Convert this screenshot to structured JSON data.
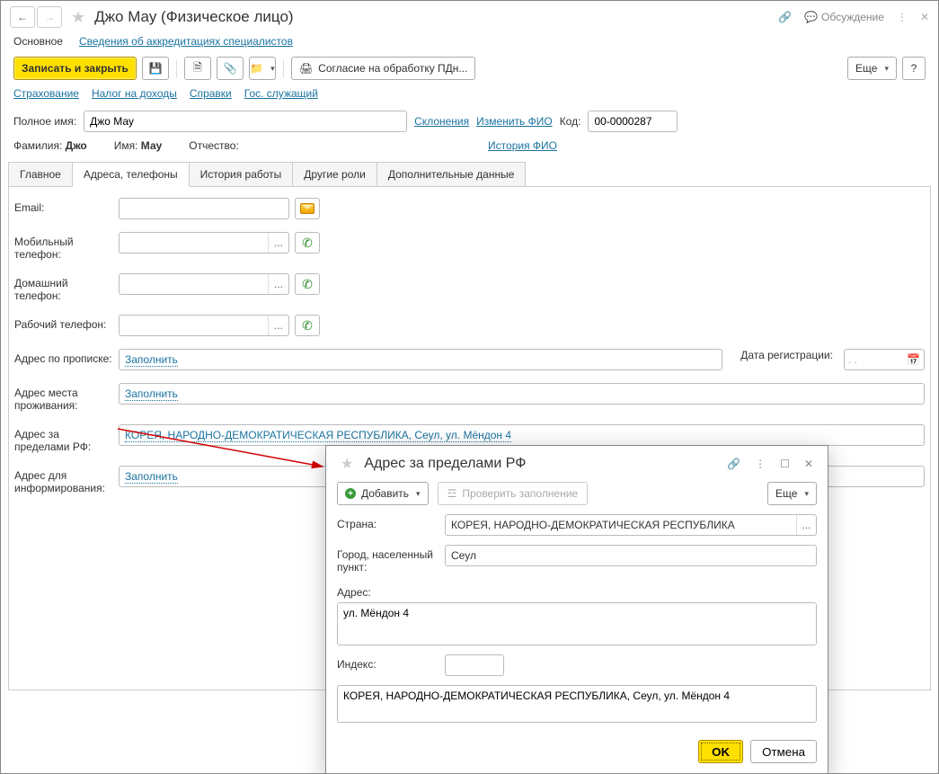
{
  "header": {
    "title": "Джо Мау (Физическое лицо)",
    "discussion": "Обсуждение"
  },
  "subnav": {
    "main": "Основное",
    "accred": "Сведения об аккредитациях специалистов"
  },
  "toolbar": {
    "save_close": "Записать и закрыть",
    "consent": "Согласие на обработку ПДн...",
    "more": "Еще",
    "help": "?"
  },
  "links": {
    "insurance": "Страхование",
    "tax": "Налог на доходы",
    "certs": "Справки",
    "gov": "Гос. служащий"
  },
  "nameRow": {
    "full_label": "Полное имя:",
    "full_value": "Джо Мау",
    "declension": "Склонения",
    "change": "Изменить ФИО",
    "code_label": "Код:",
    "code_value": "00-0000287"
  },
  "nameParts": {
    "surname_lbl": "Фамилия:",
    "surname": "Джо",
    "name_lbl": "Имя:",
    "name": "Мау",
    "patr_lbl": "Отчество:",
    "history": "История ФИО"
  },
  "tabs": {
    "main": "Главное",
    "addr": "Адреса, телефоны",
    "work": "История работы",
    "roles": "Другие роли",
    "extra": "Дополнительные данные"
  },
  "fields": {
    "email": "Email:",
    "mobile": "Мобильный телефон:",
    "home": "Домашний телефон:",
    "work": "Рабочий телефон:",
    "reg_addr": "Адрес по прописке:",
    "fill": "Заполнить",
    "reg_date": "Дата регистрации:",
    "date_placeholder": ". .",
    "live_addr": "Адрес места проживания:",
    "foreign_addr": "Адрес за пределами РФ:",
    "foreign_value": "КОРЕЯ, НАРОДНО-ДЕМОКРАТИЧЕСКАЯ РЕСПУБЛИКА, Сеул, ул. Мёндон 4",
    "inform_addr": "Адрес для информирования:"
  },
  "popup": {
    "title": "Адрес за пределами РФ",
    "add": "Добавить",
    "check": "Проверить заполнение",
    "more": "Еще",
    "country_lbl": "Страна:",
    "country": "КОРЕЯ, НАРОДНО-ДЕМОКРАТИЧЕСКАЯ РЕСПУБЛИКА",
    "city_lbl": "Город, населенный пункт:",
    "city": "Сеул",
    "addr_lbl": "Адрес:",
    "addr": "ул. Мёндон 4",
    "index_lbl": "Индекс:",
    "summary": "КОРЕЯ, НАРОДНО-ДЕМОКРАТИЧЕСКАЯ РЕСПУБЛИКА, Сеул, ул. Мёндон 4",
    "ok": "OK",
    "cancel": "Отмена"
  }
}
